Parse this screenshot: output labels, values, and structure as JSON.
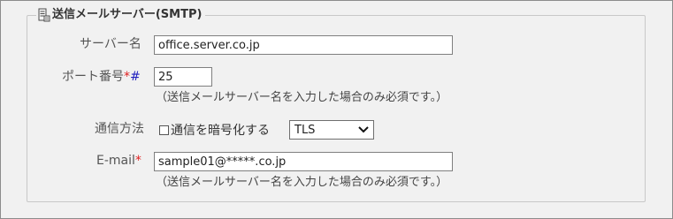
{
  "fieldset": {
    "legend": "送信メールサーバー(SMTP)"
  },
  "server_name": {
    "label": "サーバー名",
    "value": "office.server.co.jp"
  },
  "port": {
    "label": "ポート番号",
    "required_mark": "*",
    "hash_mark": "#",
    "value": "25",
    "note": "（送信メールサーバー名を入力した場合のみ必須です。）"
  },
  "encryption": {
    "label": "通信方法",
    "checkbox_label": "通信を暗号化する",
    "checked": false,
    "selected": "TLS"
  },
  "email": {
    "label": "E-mail",
    "required_mark": "*",
    "value": "sample01@*****.co.jp",
    "note": "（送信メールサーバー名を入力した場合のみ必須です。）"
  }
}
